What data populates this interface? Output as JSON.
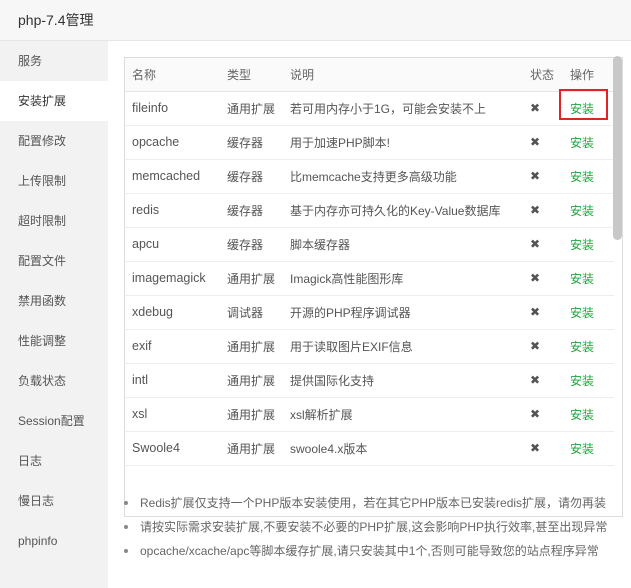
{
  "window": {
    "title": "php-7.4管理"
  },
  "sidebar": {
    "items": [
      {
        "label": "服务"
      },
      {
        "label": "安装扩展",
        "active": true
      },
      {
        "label": "配置修改"
      },
      {
        "label": "上传限制"
      },
      {
        "label": "超时限制"
      },
      {
        "label": "配置文件"
      },
      {
        "label": "禁用函数"
      },
      {
        "label": "性能调整"
      },
      {
        "label": "负载状态"
      },
      {
        "label": "Session配置"
      },
      {
        "label": "日志"
      },
      {
        "label": "慢日志"
      },
      {
        "label": "phpinfo"
      }
    ]
  },
  "table": {
    "headers": {
      "name": "名称",
      "type": "类型",
      "desc": "说明",
      "status": "状态",
      "action": "操作"
    },
    "rows": [
      {
        "name": "fileinfo",
        "type": "通用扩展",
        "desc": "若可用内存小于1G，可能会安装不上",
        "status": "✖",
        "action": "安装"
      },
      {
        "name": "opcache",
        "type": "缓存器",
        "desc": "用于加速PHP脚本!",
        "status": "✖",
        "action": "安装"
      },
      {
        "name": "memcached",
        "type": "缓存器",
        "desc": "比memcache支持更多高级功能",
        "status": "✖",
        "action": "安装"
      },
      {
        "name": "redis",
        "type": "缓存器",
        "desc": "基于内存亦可持久化的Key-Value数据库",
        "status": "✖",
        "action": "安装"
      },
      {
        "name": "apcu",
        "type": "缓存器",
        "desc": "脚本缓存器",
        "status": "✖",
        "action": "安装"
      },
      {
        "name": "imagemagick",
        "type": "通用扩展",
        "desc": "Imagick高性能图形库",
        "status": "✖",
        "action": "安装"
      },
      {
        "name": "xdebug",
        "type": "调试器",
        "desc": "开源的PHP程序调试器",
        "status": "✖",
        "action": "安装"
      },
      {
        "name": "exif",
        "type": "通用扩展",
        "desc": "用于读取图片EXIF信息",
        "status": "✖",
        "action": "安装"
      },
      {
        "name": "intl",
        "type": "通用扩展",
        "desc": "提供国际化支持",
        "status": "✖",
        "action": "安装"
      },
      {
        "name": "xsl",
        "type": "通用扩展",
        "desc": "xsl解析扩展",
        "status": "✖",
        "action": "安装"
      },
      {
        "name": "Swoole4",
        "type": "通用扩展",
        "desc": "swoole4.x版本",
        "status": "✖",
        "action": "安装"
      }
    ]
  },
  "notes": [
    "Redis扩展仅支持一个PHP版本安装使用，若在其它PHP版本已安装redis扩展，请勿再装",
    "请按实际需求安装扩展,不要安装不必要的PHP扩展,这会影响PHP执行效率,甚至出现异常",
    "opcache/xcache/apc等脚本缓存扩展,请只安装其中1个,否则可能导致您的站点程序异常"
  ],
  "colors": {
    "accent": "#20a53a",
    "highlight": "#e02424",
    "sidebar_bg": "#f2f2f2"
  }
}
